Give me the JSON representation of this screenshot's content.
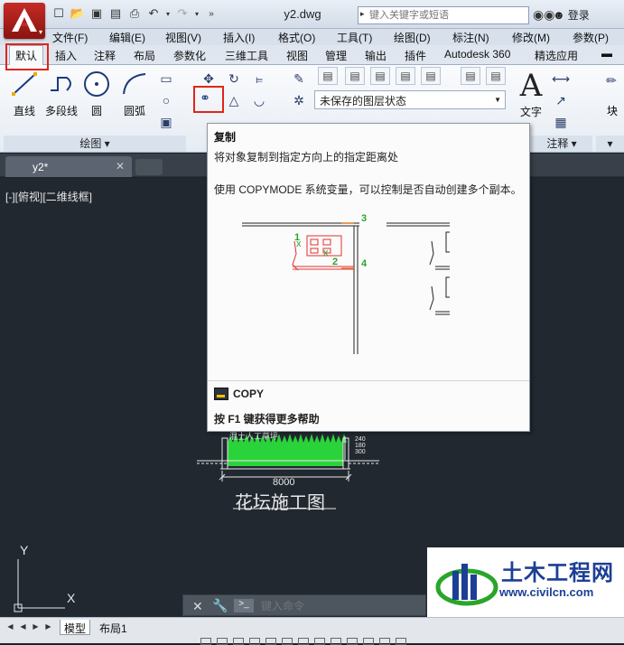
{
  "title_bar": {
    "doc_title": "y2.dwg",
    "search_placeholder": "键入关键字或短语",
    "login_label": "登录"
  },
  "menu": [
    "文件(F)",
    "编辑(E)",
    "视图(V)",
    "插入(I)",
    "格式(O)",
    "工具(T)",
    "绘图(D)",
    "标注(N)",
    "修改(M)",
    "参数(P)"
  ],
  "ribbon_tabs": [
    "默认",
    "插入",
    "注释",
    "布局",
    "参数化",
    "三维工具",
    "视图",
    "管理",
    "输出",
    "插件",
    "Autodesk 360",
    "精选应用"
  ],
  "ribbon": {
    "draw_tools": [
      "直线",
      "多段线",
      "圆",
      "圆弧"
    ],
    "draw_panel_title": "绘图",
    "layer_state": "未保存的图层状态",
    "text_label": "文字",
    "annotation_panel_title": "注释",
    "block_label": "块"
  },
  "file_tab": "y2*",
  "viewport_label": "[-][俯视][二维线框]",
  "tooltip": {
    "title": "复制",
    "description": "将对象复制到指定方向上的指定距离处",
    "extra": "使用 COPYMODE 系统变量，可以控制是否自动创建多个副本。",
    "command": "COPY",
    "help": "按 F1 键获得更多帮助",
    "callouts": [
      "1",
      "2",
      "3",
      "4"
    ]
  },
  "drawing": {
    "title": "花坛施工图",
    "dimension": "8000",
    "top_note": "混土人工草坪",
    "side_dims": [
      "240",
      "180",
      "300"
    ]
  },
  "ucs": {
    "x": "X",
    "y": "Y"
  },
  "command_line": {
    "placeholder": "键入命令"
  },
  "layout_tabs": [
    "模型",
    "布局1"
  ],
  "watermark": {
    "cn": "土木工程网",
    "url": "www.civilcn.com"
  },
  "colors": {
    "accent_red": "#e0251b",
    "brand_blue": "#1c3f95",
    "canvas": "#212830",
    "grass": "#2bd33a"
  }
}
